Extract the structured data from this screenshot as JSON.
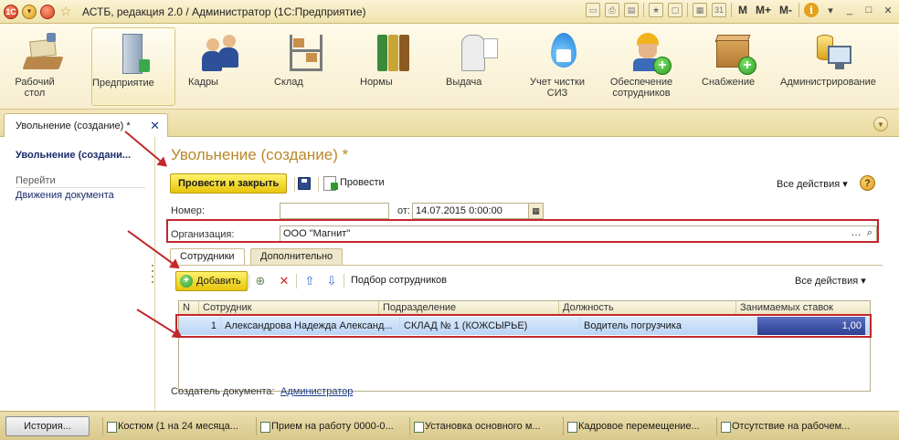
{
  "window": {
    "title": "АСТБ, редакция 2.0 / Администратор  (1С:Предприятие)",
    "toolbar": {
      "m": "M",
      "m_plus": "M+",
      "m_minus": "M-",
      "info": "i"
    }
  },
  "sections": [
    {
      "label": "Рабочий стол",
      "icon": "desktop-icon"
    },
    {
      "label": "Предприятие",
      "icon": "building-icon",
      "active": true
    },
    {
      "label": "Кадры",
      "icon": "people-icon"
    },
    {
      "label": "Склад",
      "icon": "warehouse-icon"
    },
    {
      "label": "Нормы",
      "icon": "binders-icon"
    },
    {
      "label": "Выдача",
      "icon": "issue-icon"
    },
    {
      "label": "Учет чистки СИЗ",
      "icon": "cleaning-icon"
    },
    {
      "label": "Обеспечение сотрудников",
      "icon": "worker-add-icon"
    },
    {
      "label": "Снабжение",
      "icon": "box-add-icon"
    },
    {
      "label": "Администрирование",
      "icon": "admin-icon"
    }
  ],
  "tab": {
    "label": "Увольнение (создание) *"
  },
  "leftnav": {
    "title": "Увольнение (создани...",
    "group": "Перейти",
    "link": "Движения документа"
  },
  "form": {
    "title": "Увольнение (создание) *",
    "post_close": "Провести и закрыть",
    "post": "Провести",
    "all_actions": "Все действия",
    "help": "?",
    "number_label": "Номер:",
    "number_value": "",
    "from_label": "от:",
    "date_value": "14.07.2015  0:00:00",
    "org_label": "Организация:",
    "org_value": "ООО \"Магнит\"",
    "tabs": [
      "Сотрудники",
      "Дополнительно"
    ],
    "add": "Добавить",
    "pick_staff": "Подбор сотрудников",
    "table_all_actions": "Все действия",
    "columns": [
      "N",
      "Сотрудник",
      "Подразделение",
      "Должность",
      "Занимаемых ставок"
    ],
    "rows": [
      {
        "n": "1",
        "employee": "Александрова Надежда Александ...",
        "dept": "СКЛАД № 1 (КОЖСЫРЬЕ)",
        "position": "Водитель погрузчика",
        "rate": "1,00"
      }
    ],
    "creator_label": "Создатель документа:",
    "creator_value": "Администратор"
  },
  "history": {
    "button": "История...",
    "items": [
      "Костюм (1 на 24 месяца...",
      "Прием на работу 0000-0...",
      "Установка основного м...",
      "Кадровое перемещение...",
      "Отсутствие на рабочем..."
    ]
  },
  "colors": {
    "accent": "#b8892a",
    "highlight": "#c1272d",
    "selection": "#2c3f93"
  }
}
